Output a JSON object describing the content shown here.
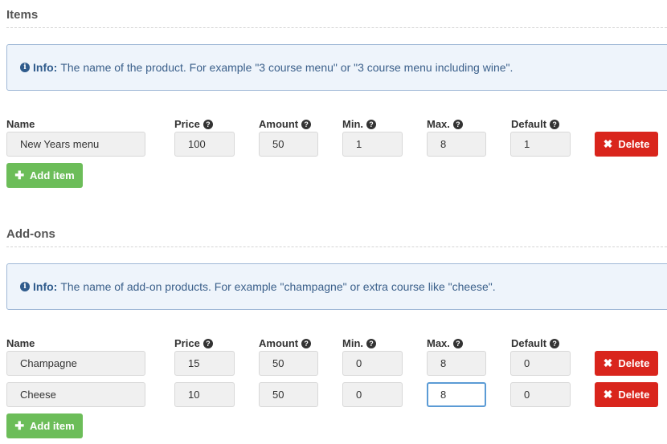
{
  "items_section": {
    "title": "Items",
    "info_label": "Info:",
    "info_text": "The name of the product. For example \"3 course menu\" or \"3 course menu including wine\".",
    "columns": [
      "Name",
      "Price",
      "Amount",
      "Min.",
      "Max.",
      "Default"
    ],
    "rows": [
      {
        "name": "New Years menu",
        "price": "100",
        "amount": "50",
        "min": "1",
        "max": "8",
        "default": "1"
      }
    ],
    "delete_label": "Delete",
    "add_label": "Add item"
  },
  "addons_section": {
    "title": "Add-ons",
    "info_label": "Info:",
    "info_text": "The name of add-on products. For example \"champagne\" or extra course like \"cheese\".",
    "columns": [
      "Name",
      "Price",
      "Amount",
      "Min.",
      "Max.",
      "Default"
    ],
    "rows": [
      {
        "name": "Champagne",
        "price": "15",
        "amount": "50",
        "min": "0",
        "max": "8",
        "default": "0"
      },
      {
        "name": "Cheese",
        "price": "10",
        "amount": "50",
        "min": "0",
        "max": "8",
        "default": "0"
      }
    ],
    "delete_label": "Delete",
    "add_label": "Add item"
  },
  "icons": {
    "info": "info-circle-icon",
    "help": "question-circle-icon",
    "delete": "times-icon",
    "add": "plus-icon"
  },
  "colors": {
    "delete_button": "#d9251c",
    "add_button": "#6cbd59",
    "info_border": "#9fb8d6",
    "info_background": "#eef4fb",
    "focus_border": "#5b9bd5"
  }
}
